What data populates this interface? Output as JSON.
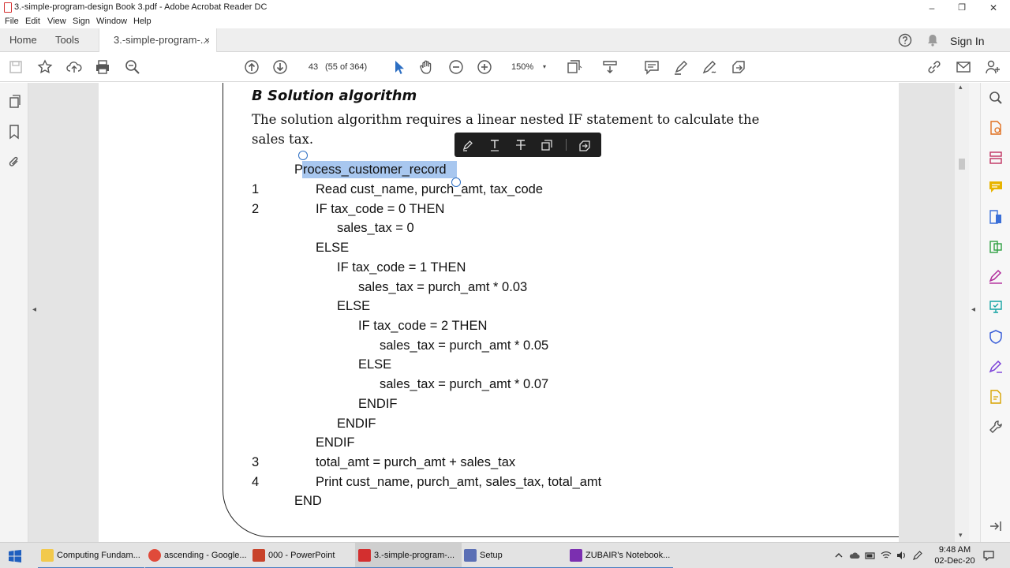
{
  "window": {
    "title": "3.-simple-program-design Book 3.pdf - Adobe Acrobat Reader DC",
    "min_glyph": "–",
    "max_glyph": "❐",
    "close_glyph": "✕"
  },
  "menu": [
    "File",
    "Edit",
    "View",
    "Sign",
    "Window",
    "Help"
  ],
  "tabs": {
    "home": "Home",
    "tools": "Tools",
    "document": "3.-simple-program-...",
    "close_glyph": "×",
    "sign_in": "Sign In"
  },
  "toolbar": {
    "page_number": "43",
    "page_count": "(55 of 364)",
    "zoom": "150%",
    "zoom_arrow": "▾"
  },
  "document": {
    "heading": "B  Solution algorithm",
    "paragraph": "The solution algorithm requires a linear nested IF statement to calculate the sales tax.",
    "code_lines": [
      {
        "num": "",
        "text": "Process_customer_record"
      },
      {
        "num": "1",
        "text": "Read cust_name, purch_amt, tax_code"
      },
      {
        "num": "2",
        "text": "IF tax_code = 0 THEN"
      },
      {
        "num": "",
        "text": "sales_tax = 0"
      },
      {
        "num": "",
        "text": "ELSE"
      },
      {
        "num": "",
        "text": "IF tax_code = 1 THEN"
      },
      {
        "num": "",
        "text": "sales_tax = purch_amt * 0.03"
      },
      {
        "num": "",
        "text": "ELSE"
      },
      {
        "num": "",
        "text": "IF tax_code = 2 THEN"
      },
      {
        "num": "",
        "text": "sales_tax = purch_amt * 0.05"
      },
      {
        "num": "",
        "text": "ELSE"
      },
      {
        "num": "",
        "text": "sales_tax = purch_amt * 0.07"
      },
      {
        "num": "",
        "text": "ENDIF"
      },
      {
        "num": "",
        "text": "ENDIF"
      },
      {
        "num": "",
        "text": "ENDIF"
      },
      {
        "num": "3",
        "text": "total_amt = purch_amt + sales_tax"
      },
      {
        "num": "4",
        "text": "Print cust_name, purch_amt, sales_tax, total_amt"
      },
      {
        "num": "",
        "text": "END"
      }
    ],
    "selected_text": "Process_customer_record"
  },
  "panes": {
    "left_arrow": "◂",
    "right_arrow": "◂",
    "scroll_up": "▴",
    "scroll_down": "▾"
  },
  "taskbar": {
    "items": [
      {
        "label": "Computing Fundam...",
        "color": "#f2c94c"
      },
      {
        "label": "ascending - Google...",
        "color": "#e04a3a"
      },
      {
        "label": "000 - PowerPoint",
        "color": "#c8432b"
      },
      {
        "label": "3.-simple-program-...",
        "color": "#d32f2f"
      },
      {
        "label": "Setup",
        "color": "#5b6fb5"
      },
      {
        "label": "ZUBAIR's Notebook...",
        "color": "#7b2fb0"
      }
    ],
    "time": "9:48 AM",
    "date": "02-Dec-20"
  },
  "colors": {
    "selection": "#a8c7ef",
    "handle": "#2d6fc3",
    "accent_blue": "#2d6fc3",
    "annot_yellow": "#e8b400",
    "pdf_red": "#d32f2f"
  }
}
